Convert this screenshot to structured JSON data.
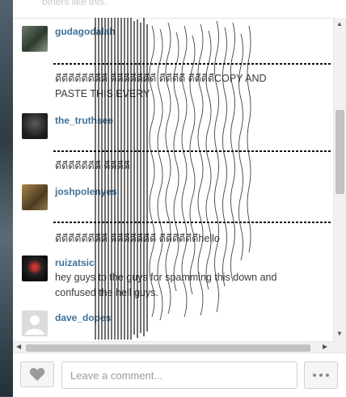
{
  "top_snippet": "others like this.",
  "comments": [
    {
      "username": "gudagodalah",
      "text": "ดีดีดีดีดีดีดีดี ดีดีดีดีดีดีดี ดีดีดีดี ดีดีดีดีCOPY AND PASTE THIS EVERY"
    },
    {
      "username": "the_truthsee",
      "text": "ดีดีดีดีดีดีดี ดีดีดีดี"
    },
    {
      "username": "joshpolenyes",
      "text": "ดีดีดีดีดีดีดีดี ดีดีดีดีดีดีดี ดีดีดีดีดีดีhello"
    },
    {
      "username": "ruizatsic",
      "text": "hey guys to the guys for spamming this down and confused the hell guys."
    },
    {
      "username": "dave_dopes",
      "text": ""
    }
  ],
  "footer": {
    "comment_placeholder": "Leave a comment..."
  },
  "colors": {
    "username": "#3f729b",
    "text": "#3a3a3a"
  }
}
